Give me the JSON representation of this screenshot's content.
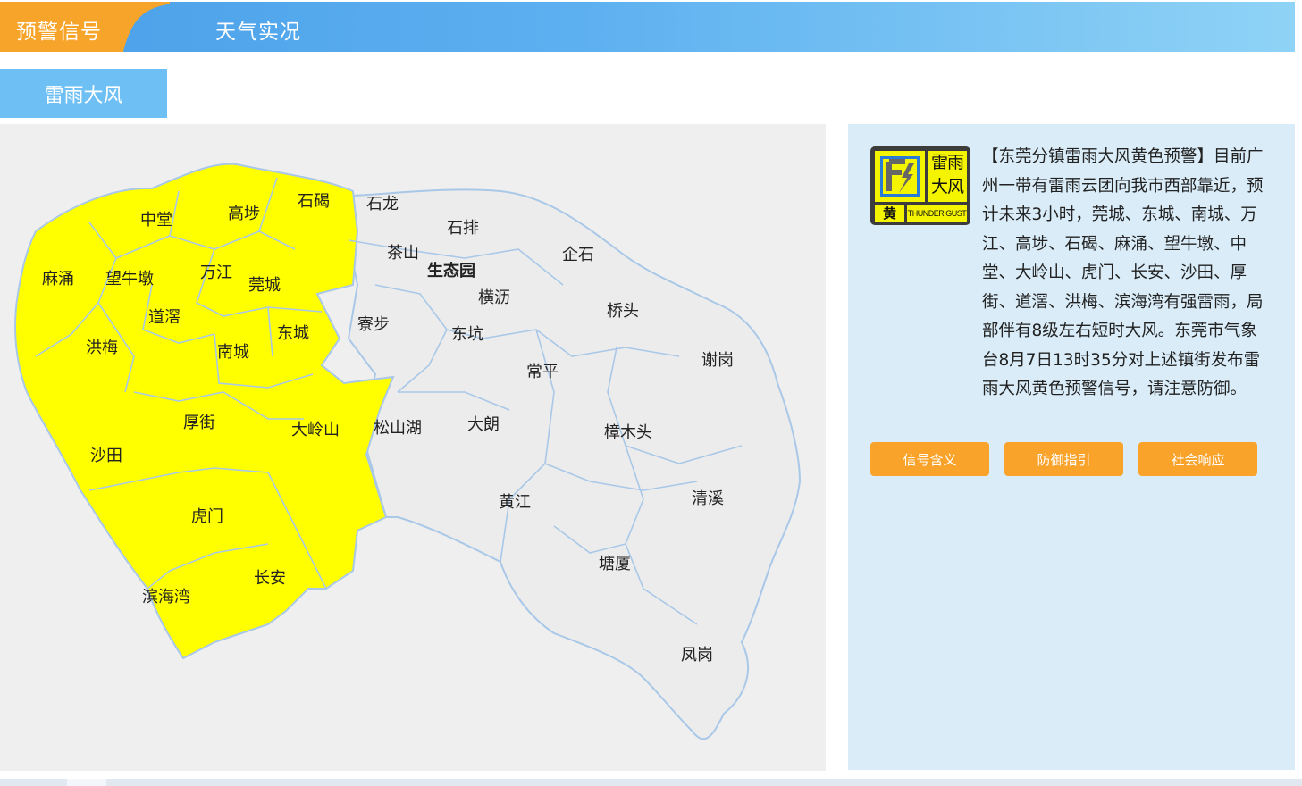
{
  "header": {
    "warning_tab_label": "预警信号",
    "live_tab_label": "天气实况",
    "accent_orange": "#f7a42a",
    "bar_color_start": "#4a9fe8",
    "bar_color_end": "#8fd3f6"
  },
  "subtab": {
    "label": "雷雨大风"
  },
  "map": {
    "warning_fill": "#ffff00",
    "normal_fill": "#ececec",
    "border_color": "#a9c8e8",
    "warned_towns": [
      "中堂",
      "高埗",
      "石碣",
      "麻涌",
      "望牛墩",
      "万江",
      "莞城",
      "道滘",
      "洪梅",
      "南城",
      "东城",
      "厚街",
      "大岭山",
      "沙田",
      "虎门",
      "长安",
      "滨海湾"
    ],
    "other_towns": [
      "石龙",
      "石排",
      "茶山",
      "生态园",
      "企石",
      "横沥",
      "寮步",
      "东坑",
      "桥头",
      "谢岗",
      "常平",
      "松山湖",
      "大朗",
      "樟木头",
      "黄江",
      "清溪",
      "塘厦",
      "凤岗"
    ]
  },
  "signal_icon": {
    "name": "thunder-gust-yellow-icon",
    "chars_line1": "雷雨",
    "chars_line2": "大风",
    "level": "黄",
    "english": "THUNDER GUST"
  },
  "warning_text": "【东莞分镇雷雨大风黄色预警】目前广州一带有雷雨云团向我市西部靠近，预计未来3小时，莞城、东城、南城、万江、高埗、石碣、麻涌、望牛墩、中堂、大岭山、虎门、长安、沙田、厚街、道滘、洪梅、滨海湾有强雷雨，局部伴有8级左右短时大风。东莞市气象台8月7日13时35分对上述镇街发布雷雨大风黄色预警信号，请注意防御。",
  "buttons": {
    "meaning": "信号含义",
    "guide": "防御指引",
    "response": "社会响应"
  }
}
